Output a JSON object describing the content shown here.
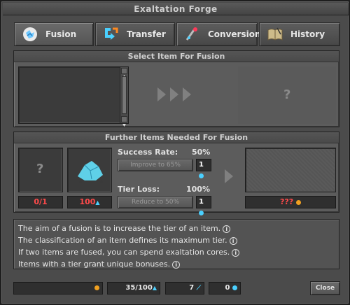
{
  "window": {
    "title": "Exaltation Forge"
  },
  "tabs": [
    {
      "label": "Fusion",
      "icon": "fusion-icon"
    },
    {
      "label": "Transfer",
      "icon": "transfer-icon"
    },
    {
      "label": "Conversion",
      "icon": "conversion-icon"
    },
    {
      "label": "History",
      "icon": "history-icon"
    }
  ],
  "select_item": {
    "header": "Select Item For Fusion",
    "result_placeholder": "?"
  },
  "further_items": {
    "header": "Further Items Needed For Fusion",
    "item_slot": {
      "placeholder": "?",
      "counter": "0/1"
    },
    "dust_slot": {
      "counter": "100"
    },
    "success_rate": {
      "label": "Success Rate:",
      "value": "50%",
      "button": "Improve to 65%",
      "count": "1"
    },
    "tier_loss": {
      "label": "Tier Loss:",
      "value": "100%",
      "button": "Reduce to 50%",
      "count": "1"
    },
    "result_counter": "???"
  },
  "info_lines": [
    "The aim of a fusion is to increase the tier of an item.",
    "The classification of an item defines its maximum tier.",
    "If two items are fused, you can spend exaltation cores.",
    "Items with a tier grant unique bonuses."
  ],
  "footer": {
    "gold": "",
    "dust": "35/100",
    "slivers": "7",
    "cores": "0",
    "close_label": "Close"
  },
  "colors": {
    "accent_red": "#ff4a4a",
    "gold": "#f0a020",
    "cyan": "#4ad0ff"
  }
}
